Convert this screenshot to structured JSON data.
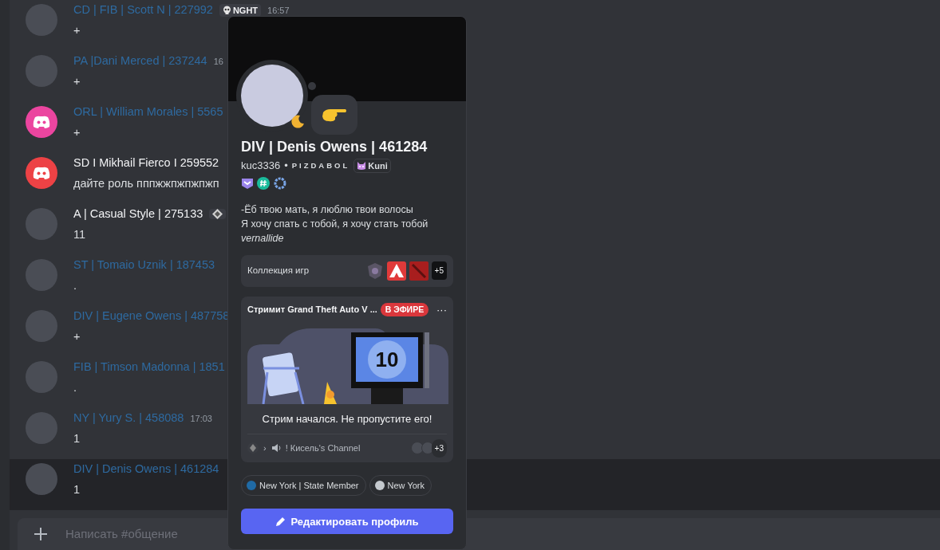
{
  "messages": [
    {
      "name": "CD | FIB | Scott N | 227992",
      "color": "#2e6aa0",
      "tag": {
        "kind": "text",
        "text": "NGHT"
      },
      "time": "16:57",
      "text": "+",
      "avatar": {
        "kind": "photo"
      },
      "highlighted": false
    },
    {
      "name": "PA |Dani Merced | 237244",
      "color": "#2e6aa0",
      "time": "16",
      "text": "+",
      "avatar": {
        "kind": "photo"
      },
      "highlighted": false
    },
    {
      "name": "ORL | William Morales | 5565",
      "color": "#2e6aa0",
      "text": "+",
      "avatar": {
        "kind": "default",
        "color": "#eb459f"
      },
      "highlighted": false
    },
    {
      "name": "SD I Mikhail Fierco I 259552",
      "color": "#f2f3f5",
      "text": "дайте роль пппжжпжпжпжп",
      "avatar": {
        "kind": "default",
        "color": "#ed4245"
      },
      "highlighted": false
    },
    {
      "name": "A | Casual Style | 275133",
      "color": "#f2f3f5",
      "tag": {
        "kind": "icon"
      },
      "text": "11",
      "avatar": {
        "kind": "photo"
      },
      "highlighted": false
    },
    {
      "name": "ST  |  Tomaio  Uznik |  187453",
      "color": "#2e6aa0",
      "text": ".",
      "avatar": {
        "kind": "photo"
      },
      "highlighted": false
    },
    {
      "name": "DIV | Eugene Owens | 487758",
      "color": "#2e6aa0",
      "text": "+",
      "avatar": {
        "kind": "photo"
      },
      "highlighted": false
    },
    {
      "name": "FIB | Timson Madonna | 1851",
      "color": "#2e6aa0",
      "text": ".",
      "avatar": {
        "kind": "photo"
      },
      "highlighted": false
    },
    {
      "name": "NY | Yury S. | 458088",
      "color": "#2e6aa0",
      "time": "17:03",
      "text": "1",
      "avatar": {
        "kind": "photo"
      },
      "highlighted": false
    },
    {
      "name": "DIV | Denis Owens | 461284",
      "color": "#2e6aa0",
      "text": "1",
      "avatar": {
        "kind": "photo"
      },
      "highlighted": true
    }
  ],
  "composer": {
    "placeholder": "Написать #общение"
  },
  "profile": {
    "display_name": "DIV | Denis Owens | 461284",
    "username": "kuc3336",
    "separator": "•",
    "pronouns": "PIZDABOL",
    "clan_tag": "Kuni",
    "bio": [
      "-Ёб твою мать, я люблю твои волосы",
      "Я хочу спать с тобой, я хочу стать тобой",
      "*vernallide*"
    ],
    "games": {
      "label": "Коллекция игр",
      "more": "+5"
    },
    "stream": {
      "title": "Стримит Grand Theft Auto V ...",
      "live_badge": "В ЭФИРЕ",
      "menu": "···",
      "countdown": "10",
      "message": "Стрим начался. Не пропустите его!",
      "chevron": "›",
      "channel": "! Кисель's Channel",
      "more_viewers": "+3"
    },
    "roles": [
      {
        "name": "New York | State Member",
        "color": "#1f6aa5"
      },
      {
        "name": "New York",
        "color": "#c4c9ce"
      }
    ],
    "edit_button": "Редактировать профиль"
  }
}
